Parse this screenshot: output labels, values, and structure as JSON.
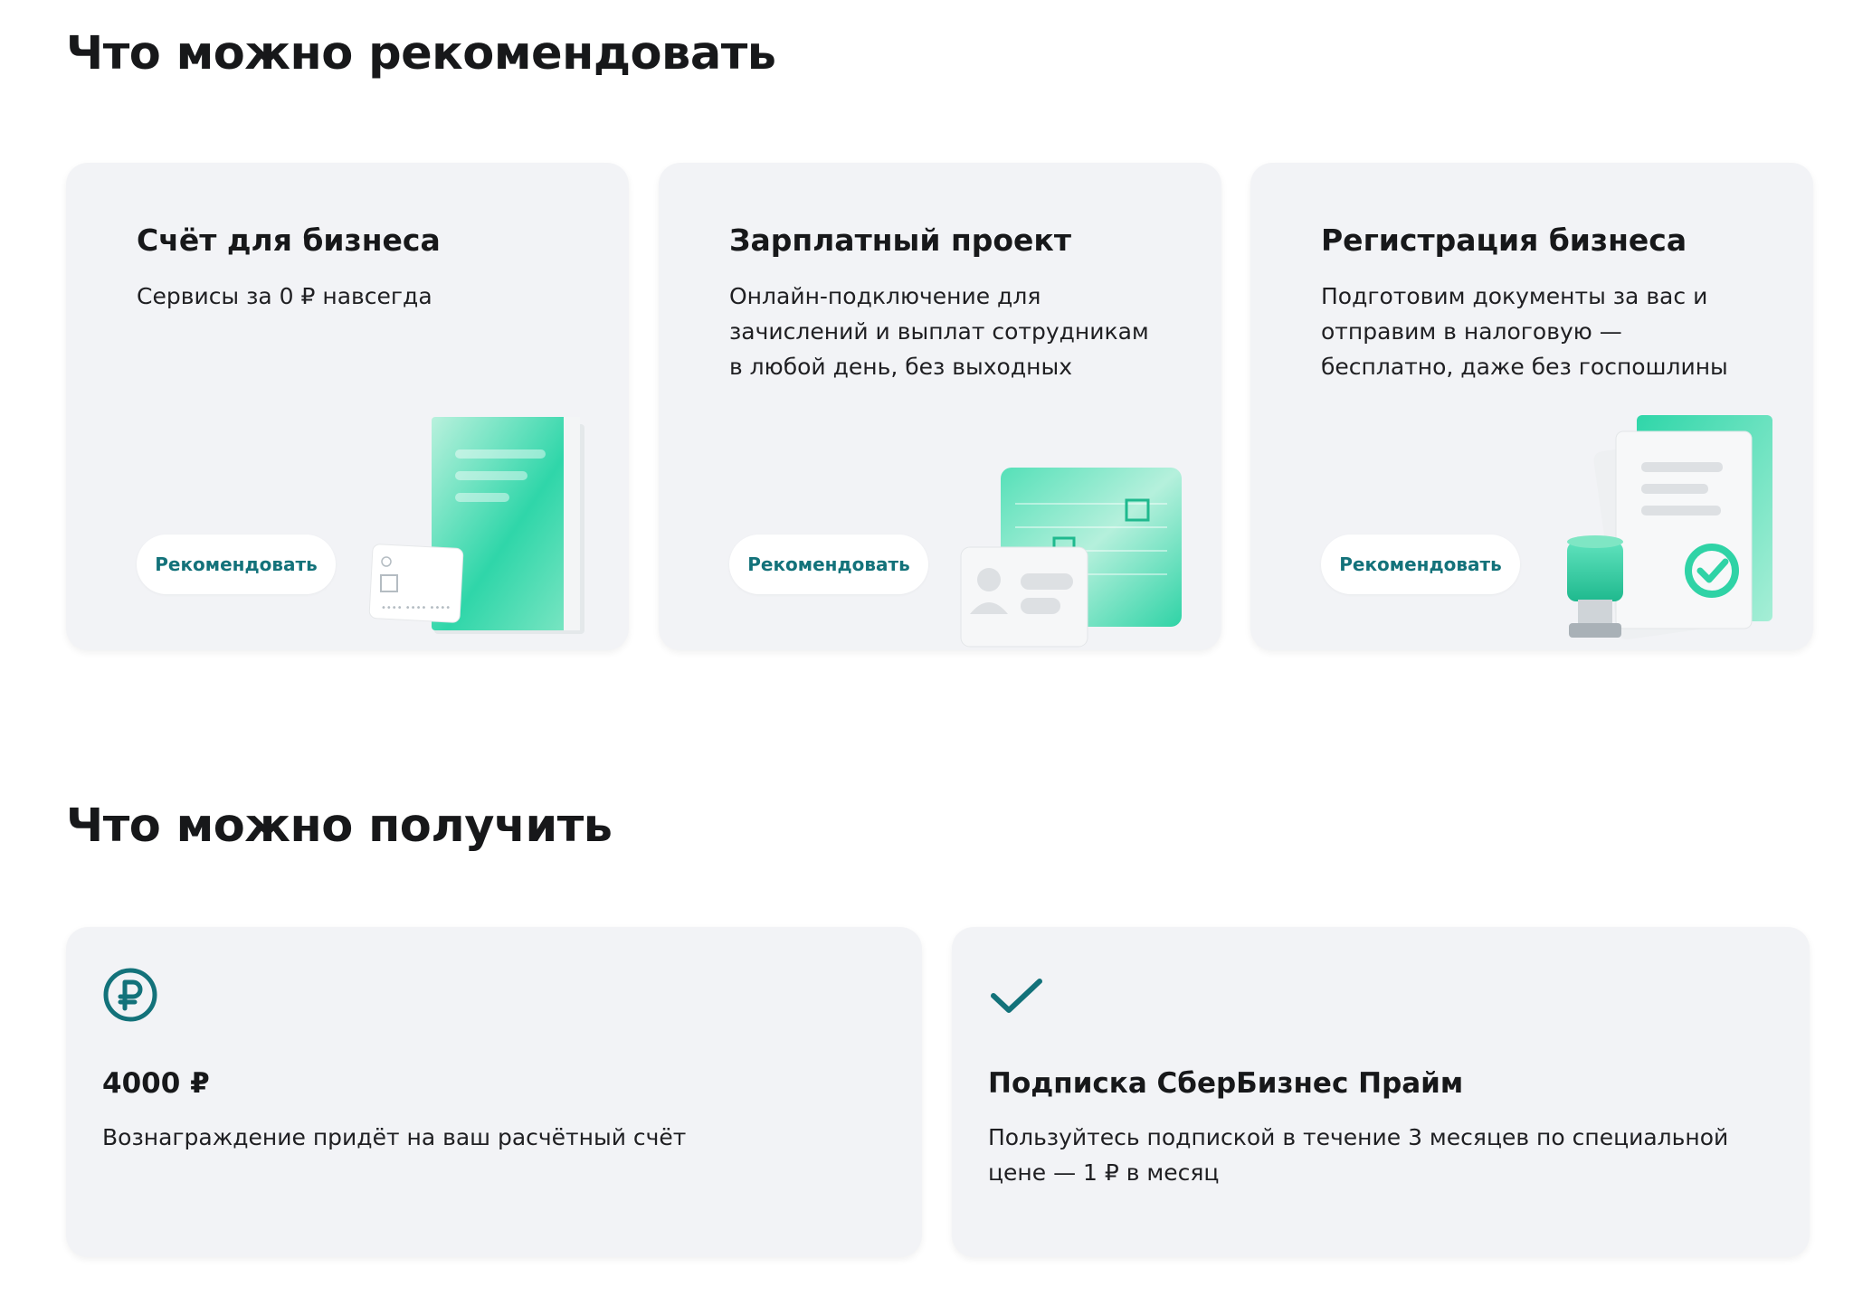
{
  "recommend": {
    "title": "Что можно рекомендовать",
    "cards": [
      {
        "title": "Счёт для бизнеса",
        "description": "Сервисы за 0 ₽ навсегда",
        "button": "Рекомендовать",
        "illustration": "folder-and-card-icon"
      },
      {
        "title": "Зарплатный проект",
        "description": "Онлайн-подключение для зачислений и выплат сотрудникам в любой день, без выходных",
        "button": "Рекомендовать",
        "illustration": "id-card-icon"
      },
      {
        "title": "Регистрация бизнеса",
        "description": "Подготовим документы за вас и отправим в налоговую — бесплатно, даже без госпошлины",
        "button": "Рекомендовать",
        "illustration": "documents-and-stamp-icon"
      }
    ]
  },
  "get": {
    "title": "Что можно получить",
    "cards": [
      {
        "icon": "ruble-circle-icon",
        "title": "4000 ₽",
        "description": "Вознаграждение придёт на ваш расчётный счёт"
      },
      {
        "icon": "checkmark-icon",
        "title": "Подписка СберБизнес Прайм",
        "description": "Пользуйтесь подпиской в течение 3 месяцев по специальной цене — 1 ₽ в месяц"
      }
    ]
  },
  "colors": {
    "accent": "#13727a",
    "mint": "#2ed3a8",
    "card_background": "#f2f3f6"
  }
}
